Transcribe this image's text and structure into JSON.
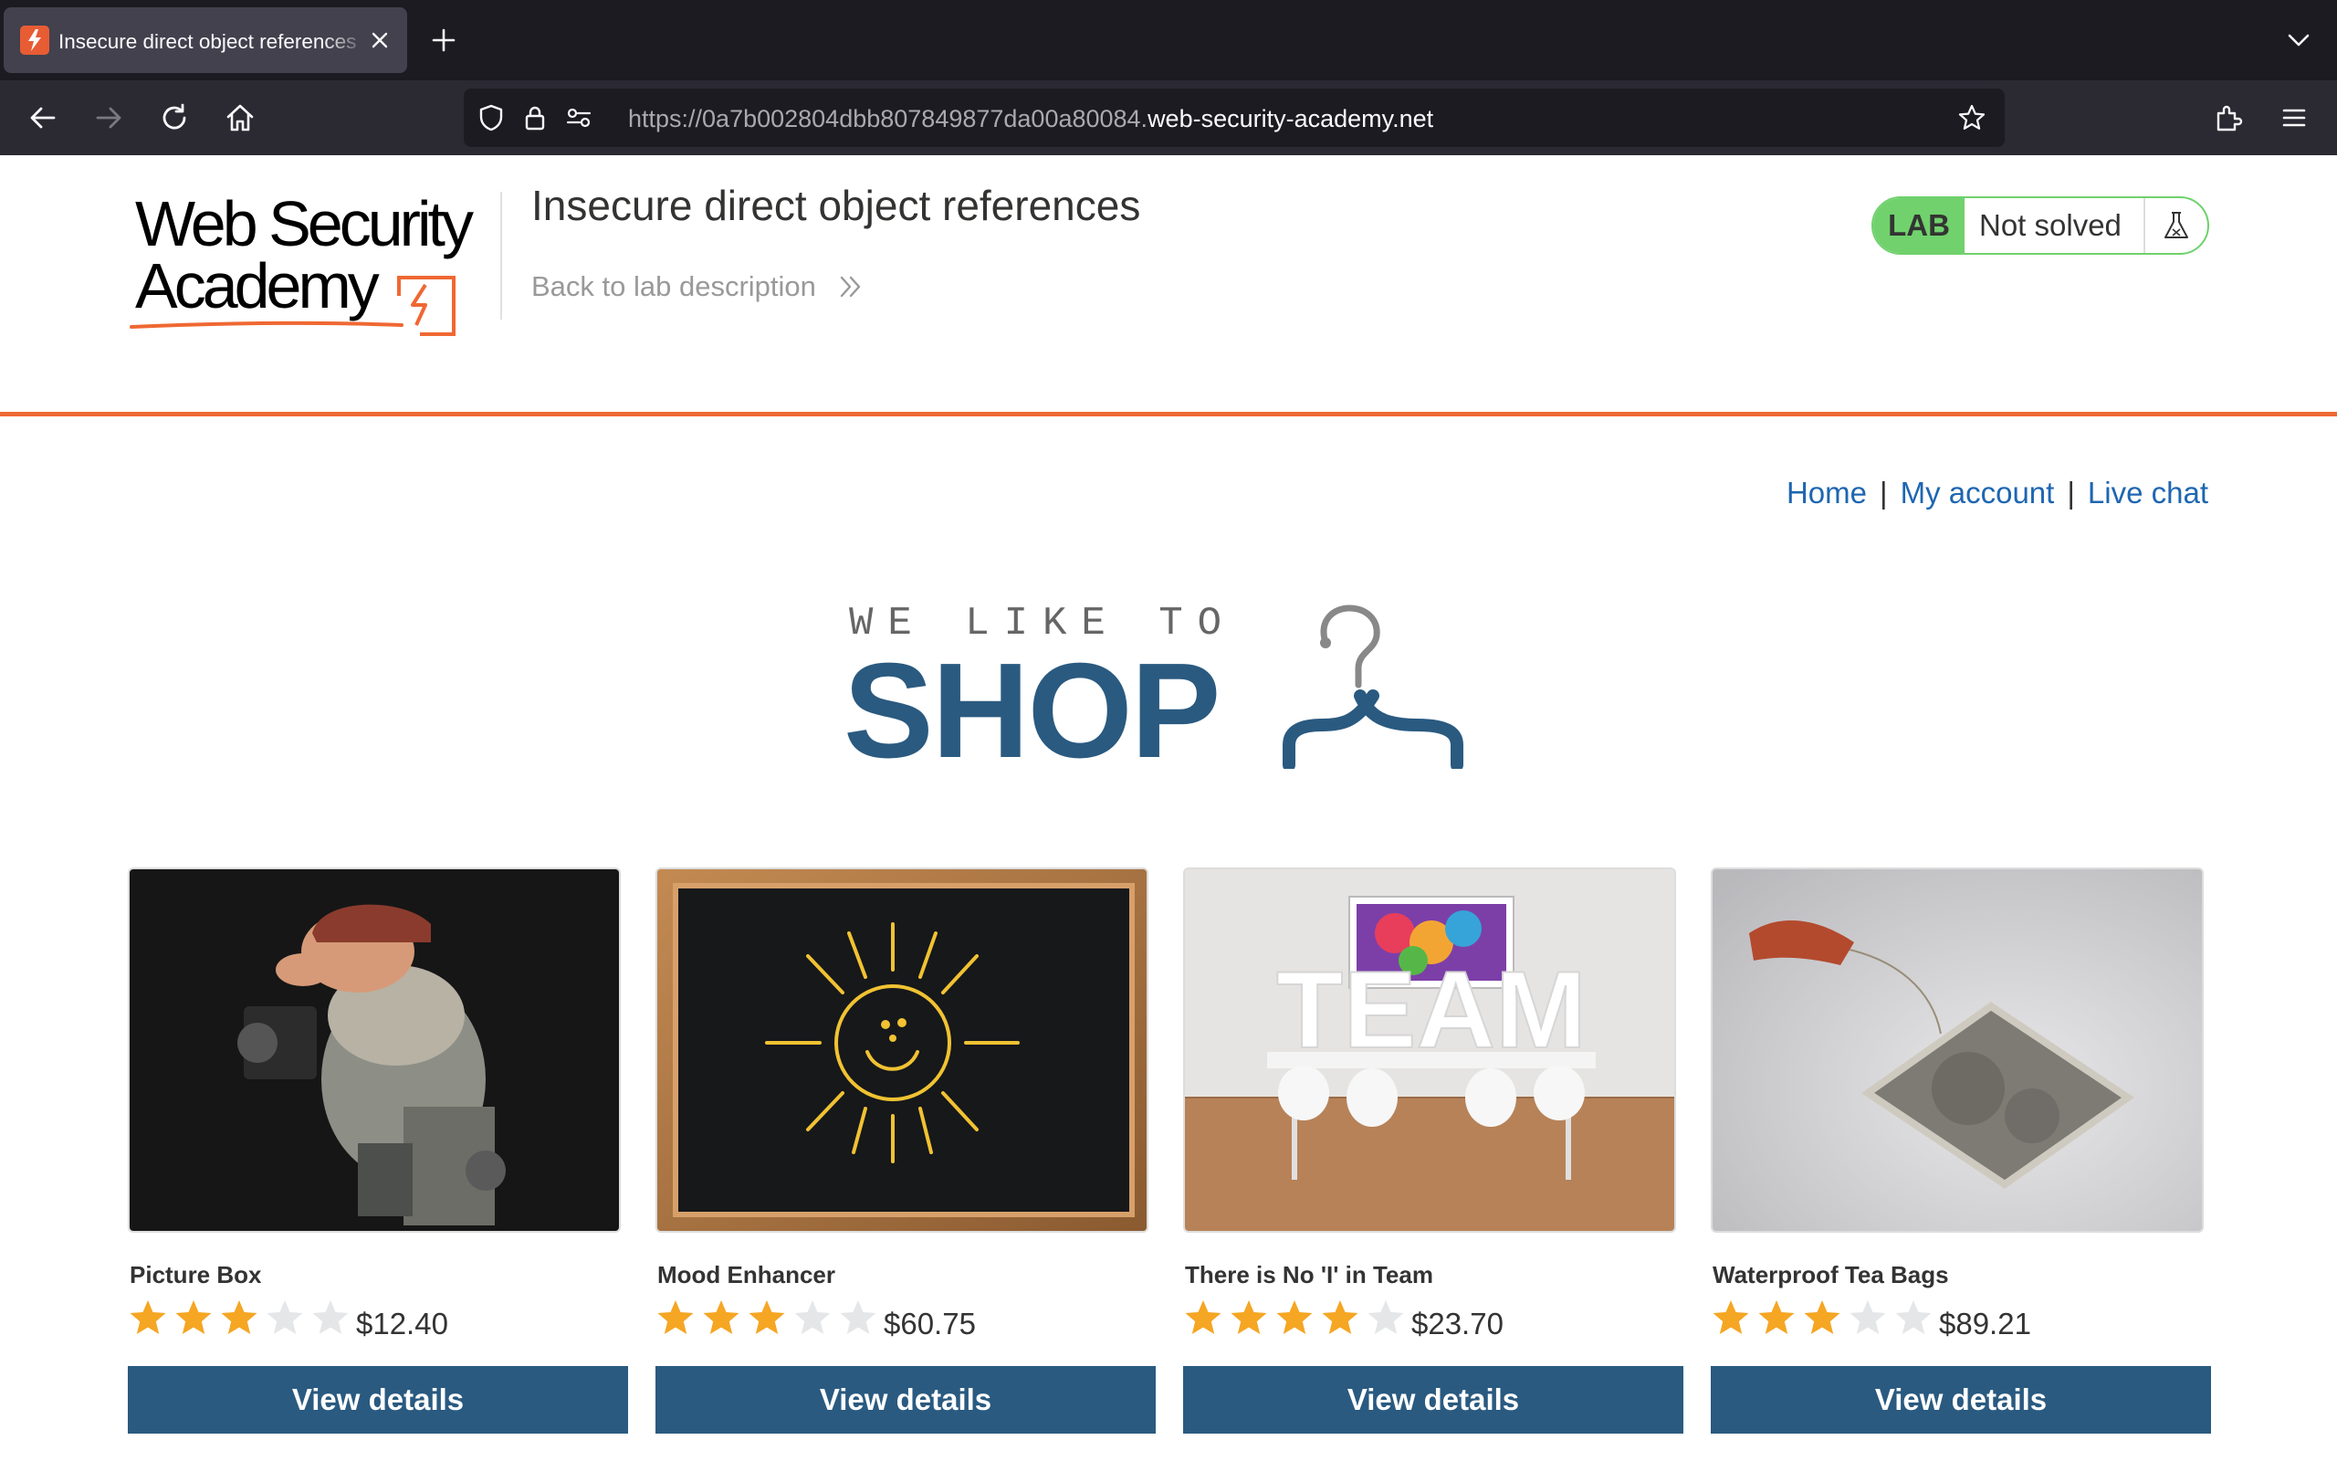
{
  "browser": {
    "tab_title": "Insecure direct object references",
    "url_prefix": "https://0a7b002804dbb807849877da00a80084.",
    "url_host": "web-security-academy.net"
  },
  "lab_header": {
    "logo_line1": "Web Security",
    "logo_line2": "Academy",
    "title": "Insecure direct object references",
    "back_link": "Back to lab description",
    "badge": "LAB",
    "status": "Not solved",
    "colors": {
      "accent": "#ef6833",
      "solved_green": "#70d16d",
      "brand_blue": "#2a5a80",
      "link_blue": "#1e66b1"
    }
  },
  "nav": {
    "home": "Home",
    "my_account": "My account",
    "live_chat": "Live chat",
    "separator": "|"
  },
  "banner": {
    "line1": "WE LIKE TO",
    "line2": "SHOP"
  },
  "products": [
    {
      "name": "Picture Box",
      "rating": 3,
      "max_rating": 5,
      "price": "$12.40",
      "button": "View details",
      "image": "photographer-figurine"
    },
    {
      "name": "Mood Enhancer",
      "rating": 3,
      "max_rating": 5,
      "price": "$60.75",
      "button": "View details",
      "image": "chalkboard-sun"
    },
    {
      "name": "There is No 'I' in Team",
      "rating": 4,
      "max_rating": 5,
      "price": "$23.70",
      "button": "View details",
      "image": "team-meeting-room"
    },
    {
      "name": "Waterproof Tea Bags",
      "rating": 3,
      "max_rating": 5,
      "price": "$89.21",
      "button": "View details",
      "image": "tea-bag"
    }
  ]
}
